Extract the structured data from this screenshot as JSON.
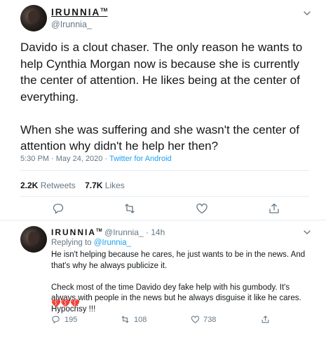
{
  "tweet": {
    "display_name": "IRUNNIA",
    "tm": "TM",
    "handle": "@Irunnia_",
    "text": "Davido is a clout chaser. The only reason he wants to help Cynthia Morgan now is because she is currently the center of attention. He likes being at the center of everything.\n\nWhen she was suffering and she wasn't the center of attention why didn't he help her then?",
    "time": "5:30 PM",
    "date": "May 24, 2020",
    "client": "Twitter for Android",
    "separator": " · ",
    "retweets": "2.2K",
    "retweets_label": "Retweets",
    "likes": "7.7K",
    "likes_label": "Likes",
    "icons": [
      "reply-icon",
      "retweet-icon",
      "like-icon",
      "share-icon",
      "chevron-down-icon"
    ]
  },
  "reply": {
    "display_name": "IRUNNIA",
    "tm": "TM",
    "handle": "@Irunnia_",
    "time": "14h",
    "separator": " · ",
    "replying_label": "Replying to",
    "replying_to": "@Irunnia_",
    "text": "He isn't helping because he cares, he just wants to be in the news. And that's why he always publicize it.\n\n Check most of the time Davido dey fake help with his gumbody. It's always with people in the news but he always disguise it like he cares. Hypocrisy !!!",
    "emoji": "💔💔💔",
    "reply_count": "195",
    "retweet_count": "108",
    "like_count": "738"
  },
  "colors": {
    "accent": "#1da1f2",
    "secondary_text": "#657786",
    "primary_text": "#14171a",
    "divider": "#e6ecf0"
  }
}
